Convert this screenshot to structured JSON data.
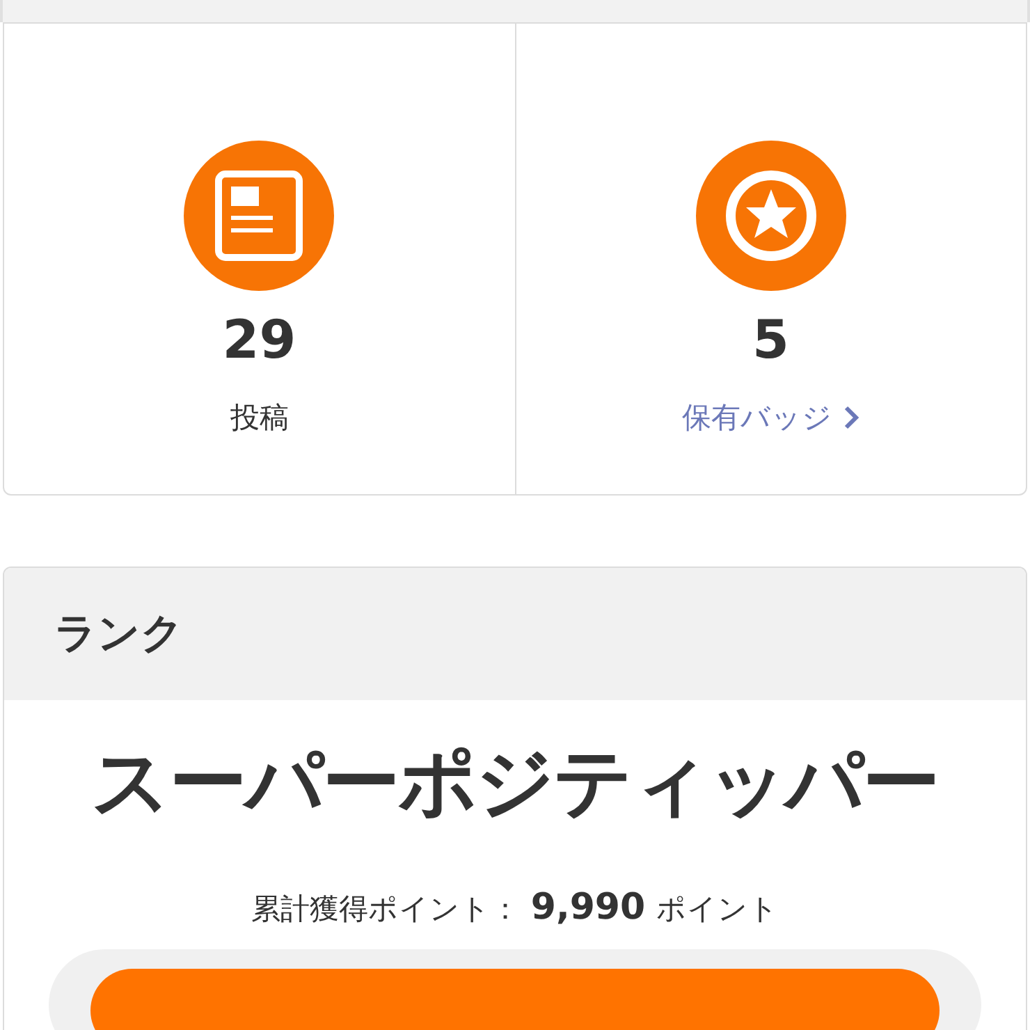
{
  "stats": [
    {
      "kind": "posts",
      "value": "29",
      "label": "投稿"
    },
    {
      "kind": "badges",
      "value": "5",
      "label": "保有バッジ"
    }
  ],
  "rank": {
    "header": "ランク",
    "name": "スーパーポジティッパー",
    "points_label": "累計獲得ポイント：",
    "points": "9,990",
    "points_unit": "ポイント"
  }
}
